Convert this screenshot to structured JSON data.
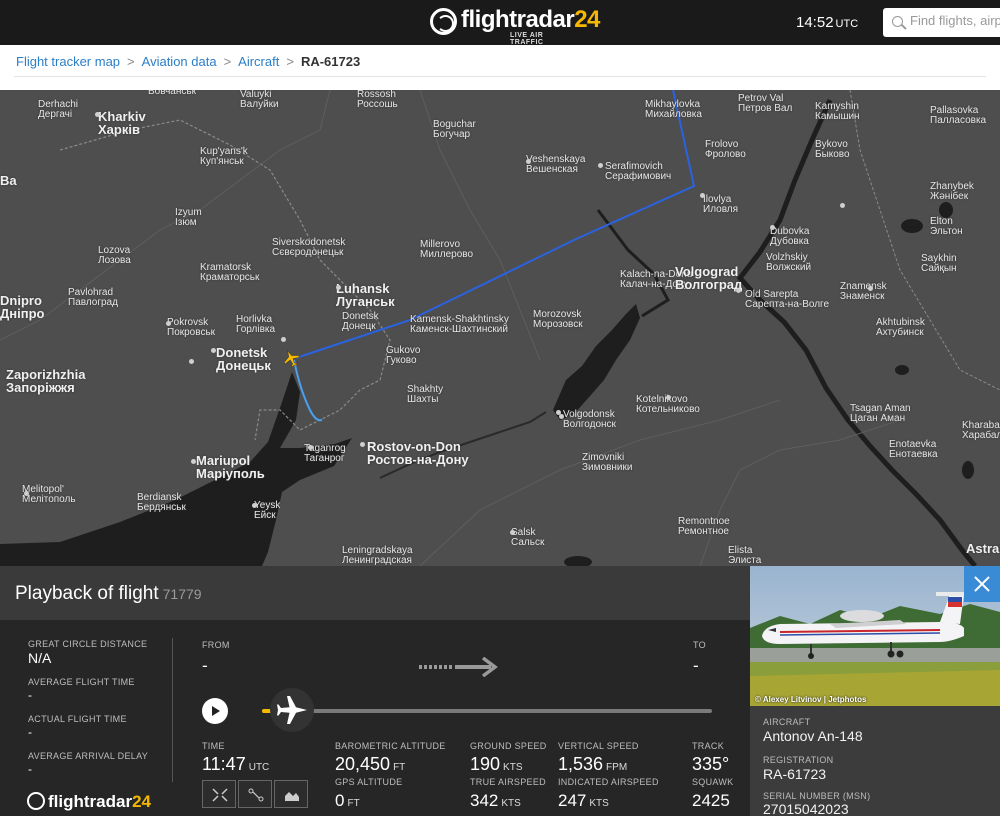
{
  "header": {
    "logo_text_main": "flightradar",
    "logo_text_num": "24",
    "logo_tagline": "LIVE AIR TRAFFIC",
    "time": "14:52",
    "time_zone": "UTC",
    "search_placeholder": "Find flights, airports"
  },
  "breadcrumb": {
    "items": [
      "Flight tracker map",
      "Aviation data",
      "Aircraft"
    ],
    "current": "RA-61723"
  },
  "map": {
    "cities": [
      {
        "en": "Derhachi",
        "local": "Дергачі"
      },
      {
        "en": "Kharkiv",
        "local": "Харків"
      },
      {
        "en": "Valuyki",
        "local": "Валуйки"
      },
      {
        "en": "Rossosh",
        "local": "Россошь"
      },
      {
        "en": "Boguchar",
        "local": "Богучар"
      },
      {
        "en": "Mikhaylovka",
        "local": "Михайловка"
      },
      {
        "en": "Petrov Val",
        "local": "Петров Вал"
      },
      {
        "en": "Kamyshin",
        "local": "Камышин"
      },
      {
        "en": "Pallasovka",
        "local": "Палласовка"
      },
      {
        "en": "Frolovo",
        "local": "Фролово"
      },
      {
        "en": "Bykovo",
        "local": "Быково"
      },
      {
        "en": "Veshenskaya",
        "local": "Вешенская"
      },
      {
        "en": "Serafimovich",
        "local": "Серафимович"
      },
      {
        "en": "Kup'yans'k",
        "local": "Куп'янськ"
      },
      {
        "en": "Zhanybek",
        "local": "Жәнібек"
      },
      {
        "en": "Izyum",
        "local": "Ізюм"
      },
      {
        "en": "Ilovlya",
        "local": "Иловля"
      },
      {
        "en": "Elton",
        "local": "Эльтон"
      },
      {
        "en": "Dubovka",
        "local": "Дубовка"
      },
      {
        "en": "Lozova",
        "local": "Лозова"
      },
      {
        "en": "Siverskodonetsk",
        "local": "Сєвєродонецьк"
      },
      {
        "en": "Millerovo",
        "local": "Миллерово"
      },
      {
        "en": "Saykhin",
        "local": "Сайқын"
      },
      {
        "en": "Volzhskiy",
        "local": "Волжский"
      },
      {
        "en": "Kramatorsk",
        "local": "Краматорськ"
      },
      {
        "en": "Kalach-na-Donu",
        "local": "Калач-на-Дону"
      },
      {
        "en": "Volgograd",
        "local": "Волгоград"
      },
      {
        "en": "Znamensk",
        "local": "Знаменск"
      },
      {
        "en": "Luhansk",
        "local": "Луганськ"
      },
      {
        "en": "Pavlohrad",
        "local": "Павлоград"
      },
      {
        "en": "Dnipro",
        "local": "Дніпро"
      },
      {
        "en": "Old Sarepta",
        "local": "Сарепта-на-Волге"
      },
      {
        "en": "Donetsk",
        "local": "Донецк"
      },
      {
        "en": "Kamensk-Shakhtinsky",
        "local": "Каменск-Шахтинский"
      },
      {
        "en": "Morozovsk",
        "local": "Морозовск"
      },
      {
        "en": "Pokrovsk",
        "local": "Покровськ"
      },
      {
        "en": "Horlivka",
        "local": "Горлівка"
      },
      {
        "en": "Akhtubinsk",
        "local": "Ахтубинск"
      },
      {
        "en": "Donetsk",
        "local": "Донецьк"
      },
      {
        "en": "Gukovo",
        "local": "Гуково"
      },
      {
        "en": "Zaporizhzhia",
        "local": "Запоріжжя"
      },
      {
        "en": "Shakhty",
        "local": "Шахты"
      },
      {
        "en": "Kotelnikovo",
        "local": "Котельниково"
      },
      {
        "en": "Volgodonsk",
        "local": "Волгодонск"
      },
      {
        "en": "Tsagan Aman",
        "local": "Цаган Аман"
      },
      {
        "en": "Kharabali",
        "local": "Харабали"
      },
      {
        "en": "Enotaevka",
        "local": "Енотаевка"
      },
      {
        "en": "Taganrog",
        "local": "Таганрог"
      },
      {
        "en": "Rostov-on-Don",
        "local": "Ростов-на-Дону"
      },
      {
        "en": "Mariupol",
        "local": "Маріуполь"
      },
      {
        "en": "Zimovniki",
        "local": "Зимовники"
      },
      {
        "en": "Melitopol'",
        "local": "Мелітополь"
      },
      {
        "en": "Berdiansk",
        "local": "Бердянськ"
      },
      {
        "en": "Yeysk",
        "local": "Ейск"
      },
      {
        "en": "Salsk",
        "local": "Сальск"
      },
      {
        "en": "Remontnoe",
        "local": "Ремонтное"
      },
      {
        "en": "Leningradskaya",
        "local": "Ленинградская"
      },
      {
        "en": "Elista",
        "local": "Элиста"
      },
      {
        "en": "Astrakhan",
        "local": ""
      }
    ],
    "edge_labels": [
      "Вовчанськ",
      "Вa"
    ],
    "route_color": "#2a62e0",
    "trail_color": "#4aa0f0"
  },
  "panel": {
    "title": "Playback of flight",
    "flight_number": "71779",
    "left_stats": [
      {
        "label": "GREAT CIRCLE DISTANCE",
        "value": "N/A"
      },
      {
        "label": "AVERAGE FLIGHT TIME",
        "value": "-"
      },
      {
        "label": "ACTUAL FLIGHT TIME",
        "value": "-"
      },
      {
        "label": "AVERAGE ARRIVAL DELAY",
        "value": "-"
      }
    ],
    "from_label": "FROM",
    "from_value": "-",
    "to_label": "TO",
    "to_value": "-",
    "playback_progress": 0.03,
    "time": {
      "label": "TIME",
      "value": "11:47",
      "unit": "UTC"
    },
    "baro_alt": {
      "label": "BAROMETRIC ALTITUDE",
      "value": "20,450",
      "unit": "FT"
    },
    "gps_alt": {
      "label": "GPS ALTITUDE",
      "value": "0",
      "unit": "FT"
    },
    "ground_speed": {
      "label": "GROUND SPEED",
      "value": "190",
      "unit": "KTS"
    },
    "true_airspeed": {
      "label": "TRUE AIRSPEED",
      "value": "342",
      "unit": "KTS"
    },
    "vertical_speed": {
      "label": "VERTICAL SPEED",
      "value": "1,536",
      "unit": "FPM"
    },
    "indicated_airspeed": {
      "label": "INDICATED AIRSPEED",
      "value": "247",
      "unit": "KTS"
    },
    "track": {
      "label": "TRACK",
      "value": "335°"
    },
    "squawk": {
      "label": "SQUAWK",
      "value": "2425"
    },
    "footer_logo_main": "flightradar",
    "footer_logo_num": "24"
  },
  "aircraft": {
    "photo_credit": "© Alexey Litvinov | Jetphotos",
    "aircraft_label": "AIRCRAFT",
    "aircraft_value": "Antonov An-148",
    "registration_label": "REGISTRATION",
    "registration_value": "RA-61723",
    "serial_label": "SERIAL NUMBER (MSN)",
    "serial_value": "27015042023"
  },
  "colors": {
    "accent_yellow": "#f5b800",
    "link_blue": "#2b7ec8",
    "close_blue": "#3a8bd6"
  }
}
